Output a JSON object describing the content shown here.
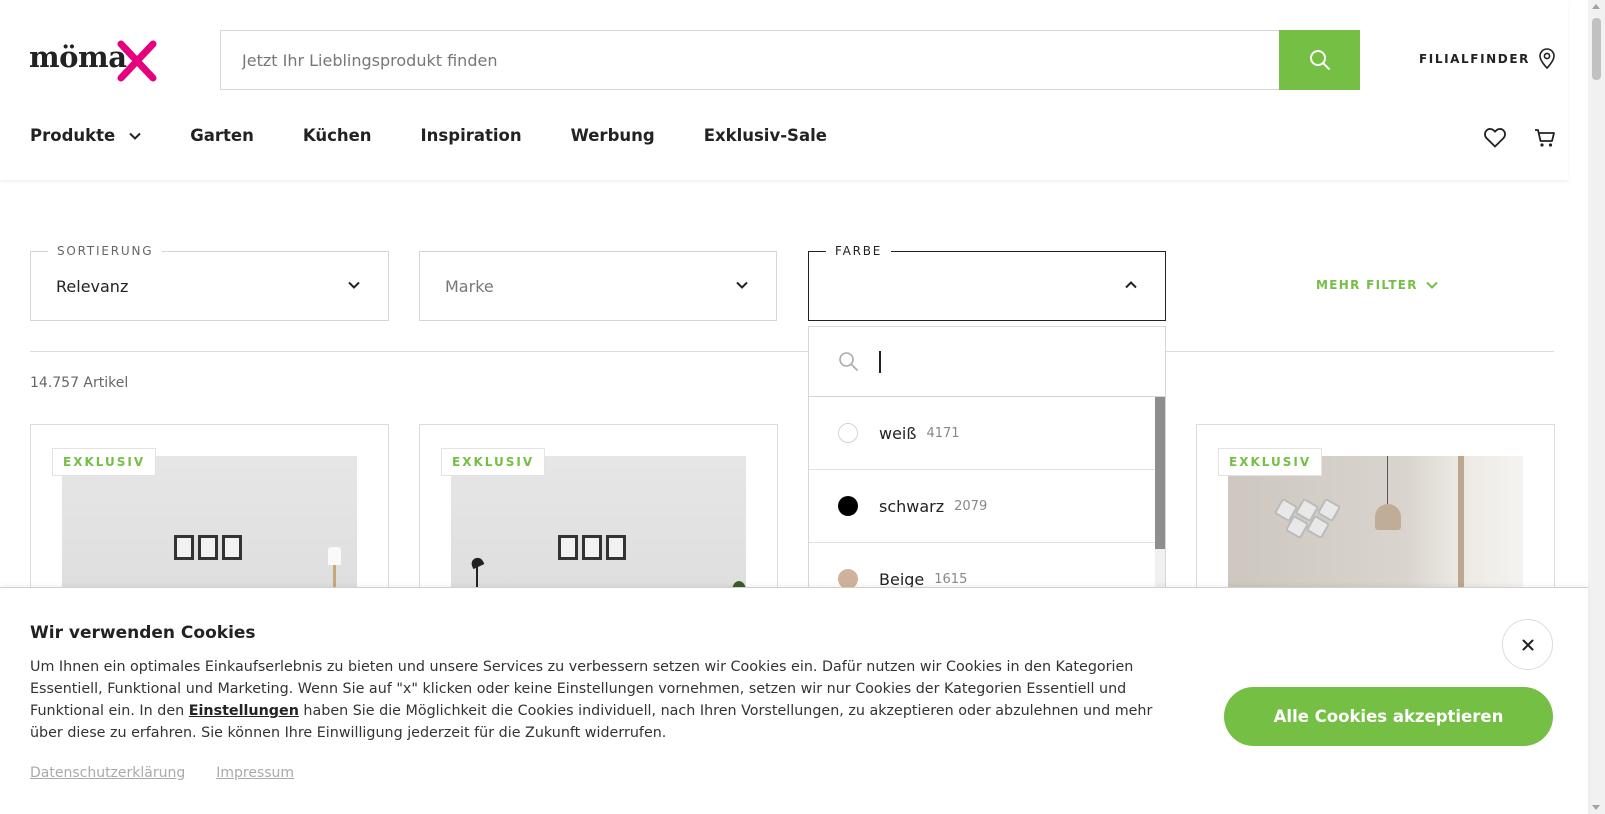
{
  "header": {
    "logo_text": "möma",
    "search_placeholder": "Jetzt Ihr Lieblingsprodukt finden",
    "filialfinder_label": "FILIALFINDER",
    "nav": [
      {
        "label": "Produkte"
      },
      {
        "label": "Garten"
      },
      {
        "label": "Küchen"
      },
      {
        "label": "Inspiration"
      },
      {
        "label": "Werbung"
      },
      {
        "label": "Exklusiv-Sale"
      }
    ],
    "brand_color": "#74bf44",
    "logo_accent_color": "#e6007e"
  },
  "filters": {
    "sort": {
      "legend": "SORTIERUNG",
      "value": "Relevanz"
    },
    "brand": {
      "placeholder": "Marke"
    },
    "color": {
      "legend": "FARBE",
      "value": ""
    },
    "more_label": "MEHR FILTER"
  },
  "results": {
    "count_label": "14.757 Artikel"
  },
  "products": [
    {
      "badge": "EXKLUSIV"
    },
    {
      "badge": "EXKLUSIV"
    },
    {
      "badge": "EXKLUSIV"
    }
  ],
  "color_dropdown": {
    "search_value": "",
    "options": [
      {
        "name": "weiß",
        "count": "4171",
        "swatch": "#ffffff"
      },
      {
        "name": "schwarz",
        "count": "2079",
        "swatch": "#000000"
      },
      {
        "name": "Beige",
        "count": "1615",
        "swatch": "#cfb29c"
      }
    ]
  },
  "cookie": {
    "title": "Wir verwenden Cookies",
    "text_before_link": "Um Ihnen ein optimales Einkaufserlebnis zu bieten und unsere Services zu verbessern setzen wir Cookies ein. Dafür nutzen wir Cookies in den Kategorien Essentiell, Funktional und Marketing. Wenn Sie auf \"x\" klicken oder keine Einstellungen vornehmen, setzen wir nur Cookies der Kategorien Essentiell und Funktional ein. In den ",
    "link_label": "Einstellungen",
    "text_after_link": " haben Sie die Möglichkeit die Cookies individuell, nach Ihren Vorstellungen, zu akzeptieren oder abzulehnen und mehr über diese zu erfahren. Sie können Ihre Einwilligung jederzeit für die Zukunft widerrufen.",
    "privacy_label": "Datenschutzerklärung",
    "imprint_label": "Impressum",
    "accept_label": "Alle Cookies akzeptieren"
  },
  "icons": [
    "search-icon",
    "location-pin-icon",
    "chevron-down-icon",
    "chevron-up-icon",
    "heart-icon",
    "cart-icon",
    "close-icon"
  ]
}
